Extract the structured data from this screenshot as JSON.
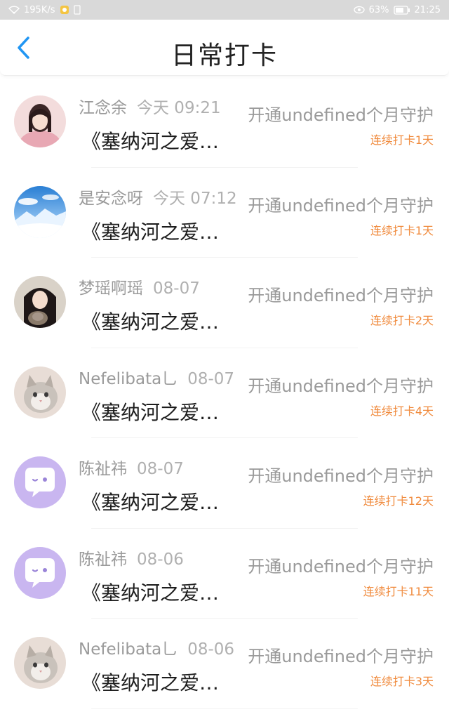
{
  "status_bar": {
    "speed": "195K/s",
    "battery": "63%",
    "time": "21:25"
  },
  "header": {
    "title": "日常打卡"
  },
  "colors": {
    "accent_blue": "#2196f3",
    "streak_orange": "#f08a3c"
  },
  "items": [
    {
      "name": "江念余",
      "time": "今天 09:21",
      "song": "《塞纳河之爱…",
      "guard": "开通undefined个月守护",
      "streak": "连续打卡1天",
      "avatar": "avatar-girl-pink"
    },
    {
      "name": "是安念呀",
      "time": "今天 07:12",
      "song": "《塞纳河之爱…",
      "guard": "开通undefined个月守护",
      "streak": "连续打卡1天",
      "avatar": "avatar-snow-landscape"
    },
    {
      "name": "梦瑶啊瑶",
      "time": "08-07",
      "song": "《塞纳河之爱…",
      "guard": "开通undefined个月守护",
      "streak": "连续打卡2天",
      "avatar": "avatar-girl-with-cat"
    },
    {
      "name": "Nefelibata乚",
      "time": "08-07",
      "song": "《塞纳河之爱…",
      "guard": "开通undefined个月守护",
      "streak": "连续打卡4天",
      "avatar": "avatar-cat"
    },
    {
      "name": "陈祉祎",
      "time": "08-07",
      "song": "《塞纳河之爱…",
      "guard": "开通undefined个月守护",
      "streak": "连续打卡12天",
      "avatar": "avatar-purple-chat"
    },
    {
      "name": "陈祉祎",
      "time": "08-06",
      "song": "《塞纳河之爱…",
      "guard": "开通undefined个月守护",
      "streak": "连续打卡11天",
      "avatar": "avatar-purple-chat"
    },
    {
      "name": "Nefelibata乚",
      "time": "08-06",
      "song": "《塞纳河之爱…",
      "guard": "开通undefined个月守护",
      "streak": "连续打卡3天",
      "avatar": "avatar-cat"
    }
  ]
}
